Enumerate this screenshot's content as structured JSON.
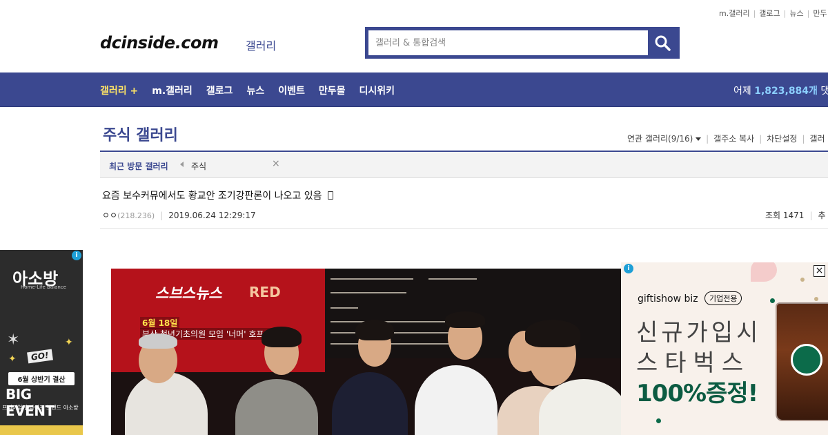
{
  "top_links": [
    "m.갤러리",
    "갤로그",
    "뉴스",
    "만두"
  ],
  "header": {
    "logo": "dcinside.com",
    "logo_sub": "갤러리",
    "search_placeholder": "갤러리 & 통합검색",
    "search_icon": "search-icon"
  },
  "nav": {
    "items": [
      {
        "label": "갤러리 +",
        "active": true
      },
      {
        "label": "m.갤러리",
        "active": false
      },
      {
        "label": "갤로그",
        "active": false
      },
      {
        "label": "뉴스",
        "active": false
      },
      {
        "label": "이벤트",
        "active": false
      },
      {
        "label": "만두몰",
        "active": false
      },
      {
        "label": "디시위키",
        "active": false
      }
    ],
    "stat_prefix": "어제",
    "stat_value": "1,823,884개",
    "stat_suffix": "댓글"
  },
  "gallery": {
    "title": "주식 갤러리",
    "links": [
      "연관 갤러리(9/16)",
      "갤주소 복사",
      "차단설정",
      "갤러"
    ],
    "recent_label": "최근 방문 갤러리",
    "recent_item": "주식",
    "recent_close": "×"
  },
  "post": {
    "title": "요즘 보수커뮤에서도 황교안 조기강판론이 나오고 있음",
    "author": "ㅇㅇ",
    "ip": "(218.236)",
    "datetime": "2019.06.24 12:29:17",
    "views_label": "조회 1471",
    "recommend_label": "추"
  },
  "video": {
    "news_logo": "스브스뉴스",
    "caption_date": "6월 18일",
    "caption_text": "부산 청년기초의원 모임 '너머' 호프 미팅",
    "wall_text": "RED"
  },
  "ad_left": {
    "brand": "아소방",
    "brand_sub": "Home-Life Balance",
    "go": "GO!",
    "date": "6월 상반기 결산",
    "headline": "BIG EVENT",
    "promo": "프리미엄 홈라이프 브랜드 아소방",
    "info": "i"
  },
  "ad_right": {
    "brand": "giftishow biz",
    "tag": "기업전용",
    "line1": "신규가입시",
    "line2": "스타벅스",
    "line3": "100%증정!",
    "info": "i",
    "close": "×"
  },
  "colors": {
    "brand_blue": "#3b4890",
    "active_nav": "#ffe566",
    "stat_num": "#8cd0ff",
    "starbucks_green": "#0c5b42"
  }
}
